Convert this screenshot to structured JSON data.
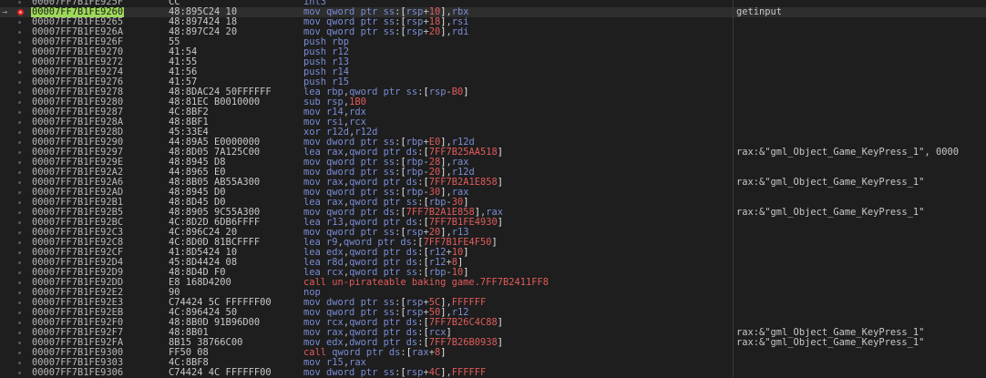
{
  "colors": {
    "background": "#1e1e1e",
    "address_current_bg": "#9ed95a",
    "breakpoint": "#e02020",
    "mnemonic": "#7a8dd6",
    "number": "#e25b5b"
  },
  "rows": [
    {
      "addr": "00007FF7B1FE925F",
      "bytes": "CC",
      "instr": "int3",
      "comment": ""
    },
    {
      "addr": "00007FF7B1FE9260",
      "bytes": "48:895C24 10",
      "instr": "mov qword ptr ss:[rsp+10],rbx",
      "comment": "getinput",
      "current": true,
      "breakpoint": true
    },
    {
      "addr": "00007FF7B1FE9265",
      "bytes": "48:897424 18",
      "instr": "mov qword ptr ss:[rsp+18],rsi",
      "comment": ""
    },
    {
      "addr": "00007FF7B1FE926A",
      "bytes": "48:897C24 20",
      "instr": "mov qword ptr ss:[rsp+20],rdi",
      "comment": ""
    },
    {
      "addr": "00007FF7B1FE926F",
      "bytes": "55",
      "instr": "push rbp",
      "comment": ""
    },
    {
      "addr": "00007FF7B1FE9270",
      "bytes": "41:54",
      "instr": "push r12",
      "comment": ""
    },
    {
      "addr": "00007FF7B1FE9272",
      "bytes": "41:55",
      "instr": "push r13",
      "comment": ""
    },
    {
      "addr": "00007FF7B1FE9274",
      "bytes": "41:56",
      "instr": "push r14",
      "comment": ""
    },
    {
      "addr": "00007FF7B1FE9276",
      "bytes": "41:57",
      "instr": "push r15",
      "comment": ""
    },
    {
      "addr": "00007FF7B1FE9278",
      "bytes": "48:8DAC24 50FFFFFF",
      "instr": "lea rbp,qword ptr ss:[rsp-B0]",
      "comment": ""
    },
    {
      "addr": "00007FF7B1FE9280",
      "bytes": "48:81EC B0010000",
      "instr": "sub rsp,1B0",
      "comment": ""
    },
    {
      "addr": "00007FF7B1FE9287",
      "bytes": "4C:8BF2",
      "instr": "mov r14,rdx",
      "comment": ""
    },
    {
      "addr": "00007FF7B1FE928A",
      "bytes": "48:8BF1",
      "instr": "mov rsi,rcx",
      "comment": ""
    },
    {
      "addr": "00007FF7B1FE928D",
      "bytes": "45:33E4",
      "instr": "xor r12d,r12d",
      "comment": ""
    },
    {
      "addr": "00007FF7B1FE9290",
      "bytes": "44:89A5 E0000000",
      "instr": "mov dword ptr ss:[rbp+E0],r12d",
      "comment": ""
    },
    {
      "addr": "00007FF7B1FE9297",
      "bytes": "48:8D05 7A125C00",
      "instr": "lea rax,qword ptr ds:[7FF7B25AA518]",
      "comment": "rax:&\"gml_Object_Game_KeyPress_1\", 0000"
    },
    {
      "addr": "00007FF7B1FE929E",
      "bytes": "48:8945 D8",
      "instr": "mov qword ptr ss:[rbp-28],rax",
      "comment": ""
    },
    {
      "addr": "00007FF7B1FE92A2",
      "bytes": "44:8965 E0",
      "instr": "mov dword ptr ss:[rbp-20],r12d",
      "comment": ""
    },
    {
      "addr": "00007FF7B1FE92A6",
      "bytes": "48:8B05 AB55A300",
      "instr": "mov rax,qword ptr ds:[7FF7B2A1E858]",
      "comment": "rax:&\"gml_Object_Game_KeyPress_1\""
    },
    {
      "addr": "00007FF7B1FE92AD",
      "bytes": "48:8945 D0",
      "instr": "mov qword ptr ss:[rbp-30],rax",
      "comment": ""
    },
    {
      "addr": "00007FF7B1FE92B1",
      "bytes": "48:8D45 D0",
      "instr": "lea rax,qword ptr ss:[rbp-30]",
      "comment": ""
    },
    {
      "addr": "00007FF7B1FE92B5",
      "bytes": "48:8905 9C55A300",
      "instr": "mov qword ptr ds:[7FF7B2A1E858],rax",
      "comment": "rax:&\"gml_Object_Game_KeyPress_1\""
    },
    {
      "addr": "00007FF7B1FE92BC",
      "bytes": "4C:8D2D 6DB6FFFF",
      "instr": "lea r13,qword ptr ds:[7FF7B1FE4930]",
      "comment": ""
    },
    {
      "addr": "00007FF7B1FE92C3",
      "bytes": "4C:896C24 20",
      "instr": "mov qword ptr ss:[rsp+20],r13",
      "comment": ""
    },
    {
      "addr": "00007FF7B1FE92C8",
      "bytes": "4C:8D0D 81BCFFFF",
      "instr": "lea r9,qword ptr ds:[7FF7B1FE4F50]",
      "comment": ""
    },
    {
      "addr": "00007FF7B1FE92CF",
      "bytes": "41:8D5424 10",
      "instr": "lea edx,qword ptr ds:[r12+10]",
      "comment": ""
    },
    {
      "addr": "00007FF7B1FE92D4",
      "bytes": "45:8D4424 08",
      "instr": "lea r8d,qword ptr ds:[r12+8]",
      "comment": ""
    },
    {
      "addr": "00007FF7B1FE92D9",
      "bytes": "48:8D4D F0",
      "instr": "lea rcx,qword ptr ss:[rbp-10]",
      "comment": ""
    },
    {
      "addr": "00007FF7B1FE92DD",
      "bytes": "E8 168D4200",
      "instr": "call un-pirateable baking game.7FF7B2411FF8",
      "comment": ""
    },
    {
      "addr": "00007FF7B1FE92E2",
      "bytes": "90",
      "instr": "nop",
      "comment": ""
    },
    {
      "addr": "00007FF7B1FE92E3",
      "bytes": "C74424 5C FFFFFF00",
      "instr": "mov dword ptr ss:[rsp+5C],FFFFFF",
      "comment": ""
    },
    {
      "addr": "00007FF7B1FE92EB",
      "bytes": "4C:896424 50",
      "instr": "mov qword ptr ss:[rsp+50],r12",
      "comment": ""
    },
    {
      "addr": "00007FF7B1FE92F0",
      "bytes": "48:8B0D 91B96D00",
      "instr": "mov rcx,qword ptr ds:[7FF7B26C4C88]",
      "comment": ""
    },
    {
      "addr": "00007FF7B1FE92F7",
      "bytes": "48:8B01",
      "instr": "mov rax,qword ptr ds:[rcx]",
      "comment": "rax:&\"gml_Object_Game_KeyPress_1\""
    },
    {
      "addr": "00007FF7B1FE92FA",
      "bytes": "8B15 38766C00",
      "instr": "mov edx,dword ptr ds:[7FF7B26B0938]",
      "comment": "rax:&\"gml_Object_Game_KeyPress_1\""
    },
    {
      "addr": "00007FF7B1FE9300",
      "bytes": "FF50 08",
      "instr": "call qword ptr ds:[rax+8]",
      "comment": ""
    },
    {
      "addr": "00007FF7B1FE9303",
      "bytes": "4C:8BF8",
      "instr": "mov r15,rax",
      "comment": ""
    },
    {
      "addr": "00007FF7B1FE9306",
      "bytes": "C74424 4C FFFFFF00",
      "instr": "mov dword ptr ss:[rsp+4C],FFFFFF",
      "comment": ""
    }
  ]
}
